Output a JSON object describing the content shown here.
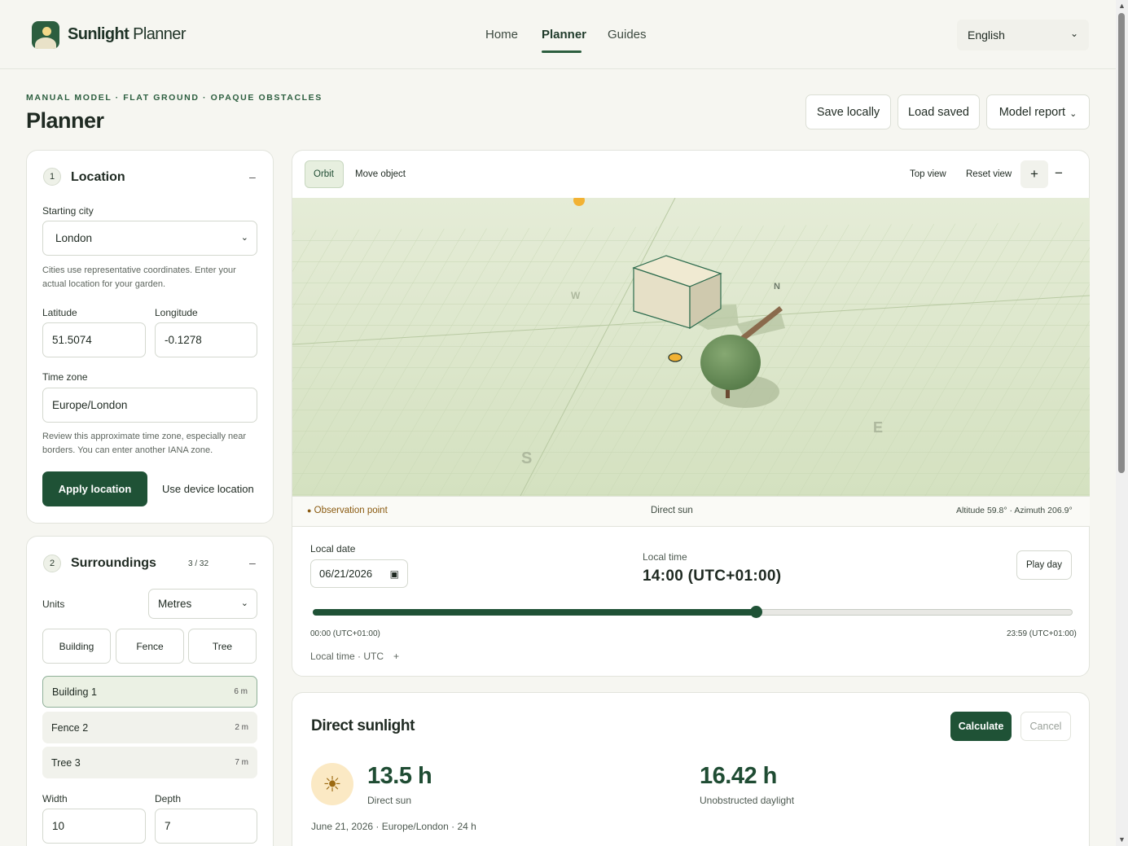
{
  "brand": {
    "name_bold": "Sunlight",
    "name_light": " Planner"
  },
  "nav": {
    "home": "Home",
    "planner": "Planner",
    "guides": "Guides"
  },
  "language": {
    "value": "English"
  },
  "header": {
    "eyebrow": "MANUAL MODEL · FLAT GROUND · OPAQUE OBSTACLES",
    "title": "Planner",
    "save": "Save locally",
    "load": "Load saved",
    "report": "Model report",
    "report_chevron": "⌄"
  },
  "location": {
    "step": "1",
    "title": "Location",
    "collapse": "–",
    "city_label": "Starting city",
    "city": "London",
    "city_hint": "Cities use representative coordinates. Enter your actual location for your garden.",
    "lat_label": "Latitude",
    "lat": "51.5074",
    "lon_label": "Longitude",
    "lon": "-0.1278",
    "tz_label": "Time zone",
    "tz": "Europe/London",
    "tz_hint": "Review this approximate time zone, especially near borders. You can enter another IANA zone.",
    "apply": "Apply location",
    "device": "Use device location"
  },
  "surroundings": {
    "step": "2",
    "title": "Surroundings",
    "count": "3 / 32",
    "collapse": "–",
    "units_label": "Units",
    "units": "Metres",
    "add_building": "Building",
    "add_fence": "Fence",
    "add_tree": "Tree",
    "objects": [
      {
        "name": "Building 1",
        "size": "6 m"
      },
      {
        "name": "Fence 2",
        "size": "2 m"
      },
      {
        "name": "Tree 3",
        "size": "7 m"
      }
    ],
    "width_label": "Width",
    "width": "10",
    "depth_label": "Depth",
    "depth": "7"
  },
  "viewer": {
    "orbit": "Orbit",
    "move": "Move object",
    "top_view": "Top view",
    "reset": "Reset view",
    "zoom_in": "+",
    "zoom_out": "−",
    "compass": {
      "n": "N",
      "s": "S",
      "e": "E",
      "w": "W"
    },
    "observation": "Observation point",
    "direct_sun": "Direct sun",
    "sun_position": "Altitude 59.8° · Azimuth 206.9°"
  },
  "time": {
    "date_label": "Local date",
    "date": "06/21/2026",
    "time_label": "Local time",
    "time": "14:00 (UTC+01:00)",
    "play": "Play day",
    "progress": 0.583,
    "start": "00:00 (UTC+01:00)",
    "end": "23:59 (UTC+01:00)",
    "toggle": "Local time · UTC",
    "toggle_plus": "+"
  },
  "results": {
    "title": "Direct sunlight",
    "calculate": "Calculate",
    "cancel": "Cancel",
    "sun_value": "13.5 h",
    "sun_label": "Direct sun",
    "daylight_value": "16.42 h",
    "daylight_label": "Unobstructed daylight",
    "meta": "June 21, 2026 · Europe/London · 24 h"
  },
  "colors": {
    "accent": "#1f5236",
    "ground": "#d7e3c4",
    "sun": "#f2b233"
  }
}
